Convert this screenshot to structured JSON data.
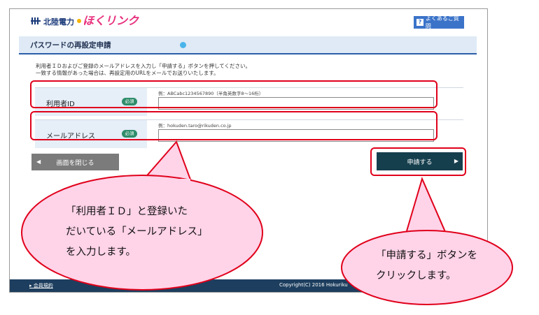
{
  "header": {
    "company": "北陸電力",
    "brand": "ほくリンク",
    "faq_label": "よくあるご質問",
    "faq_icon": "?"
  },
  "page": {
    "title": "パスワードの再設定申請",
    "description_line1": "利用者ＩＤおよびご登録のメールアドレスを入力し「申請する」ボタンを押してください。",
    "description_line2": "一致する情報があった場合は、再設定用のURLをメールでお送りいたします。"
  },
  "form": {
    "user_id_label": "利用者ID",
    "user_id_required": "必須",
    "user_id_example": "例：ABCabc1234567890（半角英数字8～16桁）",
    "user_id_value": "",
    "email_label": "メールアドレス",
    "email_required": "必須",
    "email_example": "例：hokuden.taro@rikuden.co.jp",
    "email_value": ""
  },
  "buttons": {
    "close_label": "画面を閉じる",
    "apply_label": "申請する"
  },
  "footer": {
    "terms_label": "会員規約",
    "copyright": "Copyright(C) 2016 Hokuriku"
  },
  "callouts": {
    "left_line1": "「利用者ＩＤ」と登録いた",
    "left_line2": "だいている「メールアドレス」",
    "left_line3": "を入力します。",
    "right_line1": "「申請する」ボタンを",
    "right_line2": "クリックします。"
  },
  "colors": {
    "highlight": "#e0001b",
    "callout_fill": "#ffd3e8",
    "apply_button": "#163f4e",
    "footer": "#1d3e5e"
  }
}
